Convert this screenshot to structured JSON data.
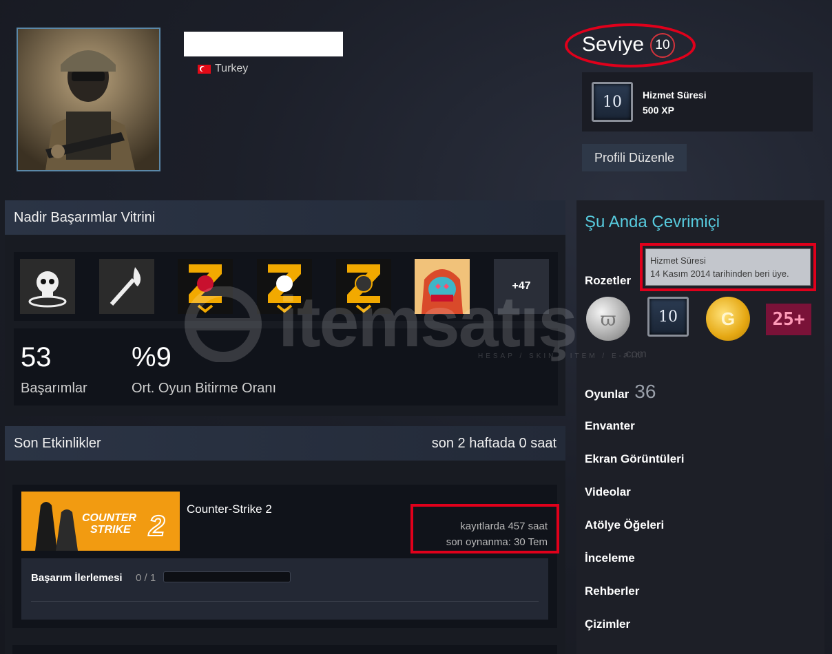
{
  "profile": {
    "country": "Turkey",
    "level_label": "Seviye",
    "level_value": "10",
    "service_badge_value": "10",
    "service_title": "Hizmet Süresi",
    "service_xp": "500 XP",
    "edit_button": "Profili Düzenle"
  },
  "showcase": {
    "title": "Nadir Başarımlar Vitrini",
    "more_count": "+47",
    "achievements_count": "53",
    "achievements_label": "Başarımlar",
    "completion_rate": "%9",
    "completion_label": "Ort. Oyun Bitirme Oranı"
  },
  "activity": {
    "title": "Son Etkinlikler",
    "summary": "son 2 haftada 0 saat",
    "game": {
      "name": "Counter-Strike 2",
      "thumb_text_1": "COUNTER",
      "thumb_text_2": "STRIKE",
      "thumb_num": "2",
      "hours": "kayıtlarda 457 saat",
      "last_played": "son oynanma: 30 Tem",
      "progress_label": "Başarım İlerlemesi",
      "progress_count": "0 / 1",
      "progress_fraction": 0
    }
  },
  "sidebar": {
    "status": "Şu Anda Çevrimiçi",
    "badges_label": "Rozetler",
    "tooltip_title": "Hizmet Süresi",
    "tooltip_text": "14 Kasım 2014 tarihinden beri üye.",
    "badge_10": "10",
    "badge_25": "25+",
    "games_label": "Oyunlar",
    "games_count": "36",
    "links": [
      "Envanter",
      "Ekran Görüntüleri",
      "Videolar",
      "Atölye Öğeleri",
      "İnceleme",
      "Rehberler",
      "Çizimler"
    ]
  },
  "watermark": {
    "text": "itemsatış",
    "sub": "HESAP / SKIN / ITEM / E-PIN",
    "com": ".com"
  },
  "colors": {
    "accent_online": "#57cbde",
    "highlight_red": "#e0001b",
    "panel_head": "#2b3445"
  }
}
